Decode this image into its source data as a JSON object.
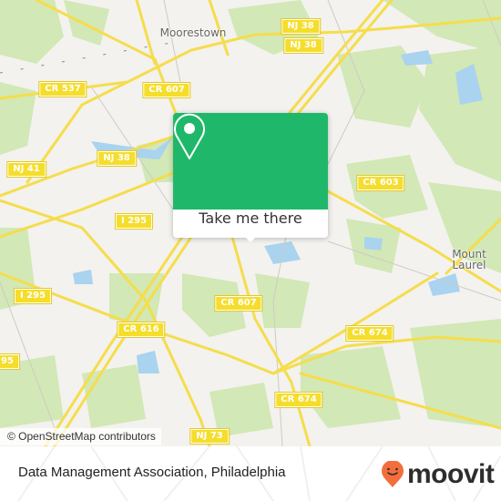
{
  "map": {
    "place_labels": [
      {
        "id": "moorestown",
        "text": "Moorestown"
      },
      {
        "id": "mount-laurel",
        "text": "Mount\nLaurel"
      }
    ],
    "road_shields": [
      {
        "id": "nj38-a",
        "text": "NJ 38"
      },
      {
        "id": "nj38-b",
        "text": "NJ 38"
      },
      {
        "id": "nj38-c",
        "text": "NJ 38"
      },
      {
        "id": "cr537",
        "text": "CR 537"
      },
      {
        "id": "cr607-a",
        "text": "CR 607"
      },
      {
        "id": "nj41",
        "text": "NJ 41"
      },
      {
        "id": "cr603",
        "text": "CR 603"
      },
      {
        "id": "i295-a",
        "text": "I 295"
      },
      {
        "id": "i295-b",
        "text": "I 295"
      },
      {
        "id": "i295-c",
        "text": "95"
      },
      {
        "id": "cr616",
        "text": "CR 616"
      },
      {
        "id": "cr607-b",
        "text": "CR 607"
      },
      {
        "id": "cr674-a",
        "text": "CR 674"
      },
      {
        "id": "cr674-b",
        "text": "CR 674"
      },
      {
        "id": "nj73",
        "text": "NJ 73"
      }
    ],
    "attribution": "© OpenStreetMap contributors",
    "colors": {
      "land": "#f3f2ee",
      "park": "#cfe6b0",
      "water": "#a9d3ef",
      "road": "#f5dd4c",
      "popup_green": "#1fb86b"
    }
  },
  "popup": {
    "button_label": "Take me there",
    "icon": "location-pin-icon"
  },
  "footer": {
    "place_name": "Data Management Association, Philadelphia",
    "brand": "moovit",
    "brand_color": "#f36e3d"
  }
}
